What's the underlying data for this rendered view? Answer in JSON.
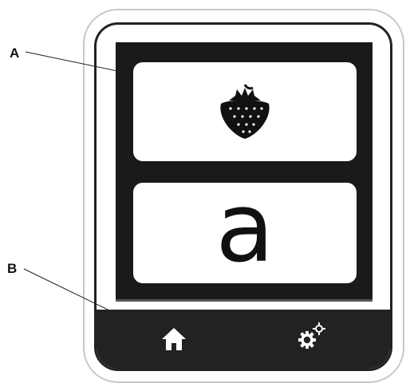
{
  "callouts": {
    "a_label": "A",
    "b_label": "B"
  },
  "screen": {
    "top_card_icon": "strawberry-icon",
    "bottom_card_text": "a"
  },
  "navbar": {
    "home_icon": "home-icon",
    "settings_icon": "settings-gears-icon"
  }
}
